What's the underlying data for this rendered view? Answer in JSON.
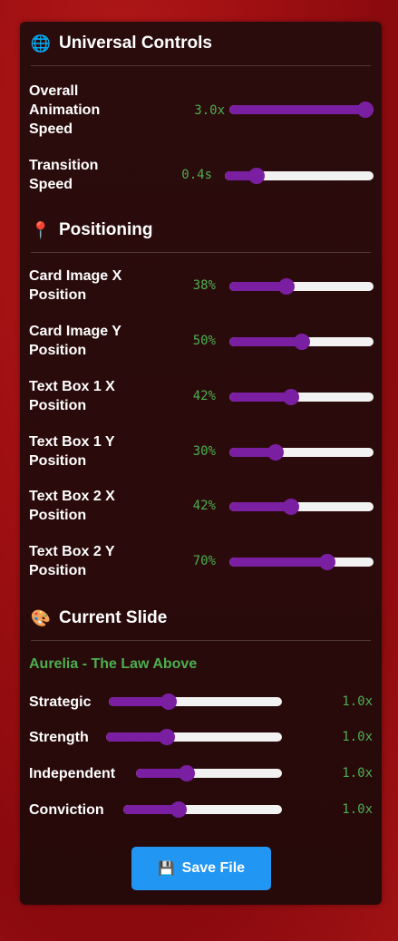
{
  "universal": {
    "icon": "globe-icon",
    "title": "Universal Controls",
    "controls": [
      {
        "label": "Overall Animation Speed",
        "value_text": "3.0x",
        "fraction": 1.0
      },
      {
        "label": "Transition Speed",
        "value_text": "0.4s",
        "fraction": 0.18
      }
    ]
  },
  "positioning": {
    "icon": "pushpin-icon",
    "title": "Positioning",
    "controls": [
      {
        "label": "Card Image X Position",
        "value_text": "38%",
        "fraction": 0.38
      },
      {
        "label": "Card Image Y Position",
        "value_text": "50%",
        "fraction": 0.5
      },
      {
        "label": "Text Box 1 X Position",
        "value_text": "42%",
        "fraction": 0.42
      },
      {
        "label": "Text Box 1 Y Position",
        "value_text": "30%",
        "fraction": 0.3
      },
      {
        "label": "Text Box 2 X Position",
        "value_text": "42%",
        "fraction": 0.42
      },
      {
        "label": "Text Box 2 Y Position",
        "value_text": "70%",
        "fraction": 0.7
      }
    ]
  },
  "current_slide": {
    "icon": "palette-icon",
    "title": "Current Slide",
    "slide_name": "Aurelia - The Law Above",
    "traits": [
      {
        "label": "Strategic",
        "value_text": "1.0x",
        "fraction": 0.33
      },
      {
        "label": "Strength",
        "value_text": "1.0x",
        "fraction": 0.33
      },
      {
        "label": "Independent",
        "value_text": "1.0x",
        "fraction": 0.33
      },
      {
        "label": "Conviction",
        "value_text": "1.0x",
        "fraction": 0.33
      }
    ]
  },
  "save_button": {
    "icon": "floppy-disk-icon",
    "label": "Save File"
  },
  "colors": {
    "accent": "#7b1fa2",
    "value_text": "#4caf50",
    "button": "#2196f3"
  }
}
